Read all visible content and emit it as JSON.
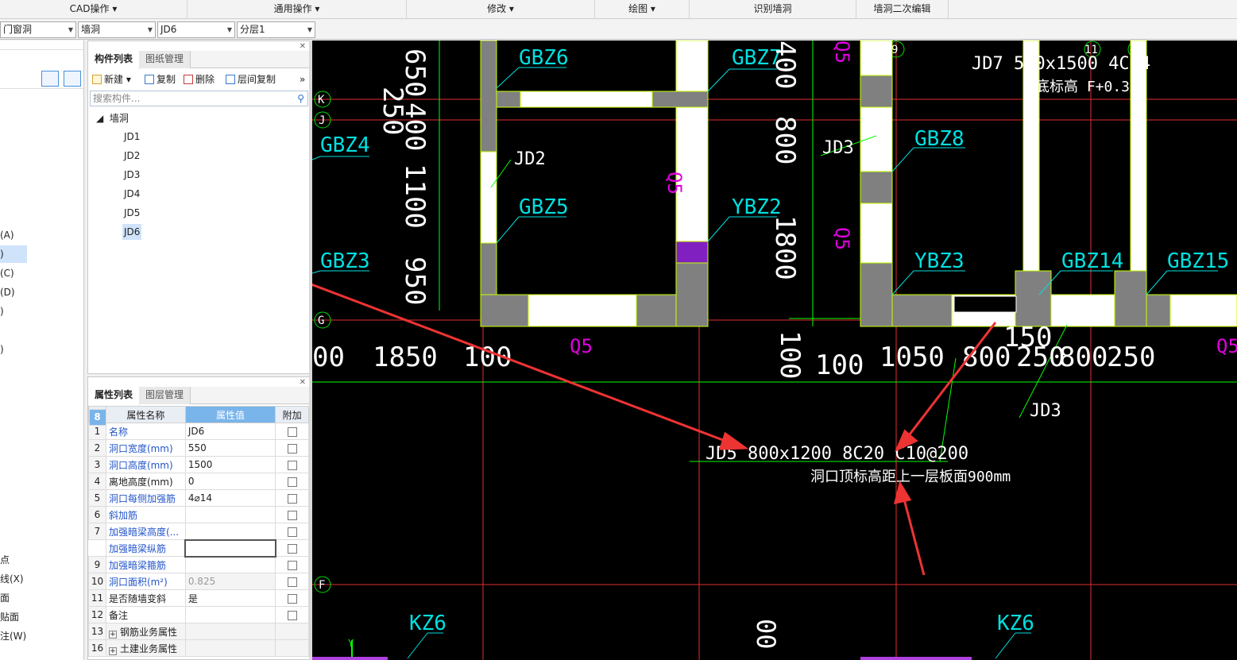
{
  "menu": {
    "items": [
      "CAD操作",
      "通用操作",
      "修改",
      "绘图",
      "识别墙洞",
      "墙洞二次编辑"
    ]
  },
  "selectors": {
    "type": "门窗洞",
    "subtype": "墙洞",
    "component": "JD6",
    "layer": "分层1"
  },
  "left_strip": {
    "items": [
      "(A)",
      ")",
      "(C)",
      "(D)",
      ")",
      ")",
      "点",
      "线(X)",
      "面",
      "贴面",
      "注(W)"
    ]
  },
  "component_panel": {
    "tab_active": "构件列表",
    "tab_inactive": "图纸管理",
    "new_label": "新建",
    "copy_label": "复制",
    "delete_label": "删除",
    "floor_copy_label": "层间复制",
    "more": "»",
    "search_placeholder": "搜索构件...",
    "tree_root": "墙洞",
    "items": [
      "JD1",
      "JD2",
      "JD3",
      "JD4",
      "JD5",
      "JD6"
    ],
    "selected": "JD6"
  },
  "property_panel": {
    "tab_active": "属性列表",
    "tab_inactive": "图层管理",
    "col_name": "属性名称",
    "col_value": "属性值",
    "col_extra": "附加",
    "rows": [
      {
        "n": "1",
        "name": "名称",
        "value": "JD6"
      },
      {
        "n": "2",
        "name": "洞口宽度(mm)",
        "value": "550"
      },
      {
        "n": "3",
        "name": "洞口高度(mm)",
        "value": "1500"
      },
      {
        "n": "4",
        "name": "离地高度(mm)",
        "value": "0"
      },
      {
        "n": "5",
        "name": "洞口每侧加强筋",
        "value": "4⌀14"
      },
      {
        "n": "6",
        "name": "斜加筋",
        "value": ""
      },
      {
        "n": "7",
        "name": "加强暗梁高度(...",
        "value": ""
      },
      {
        "n": "8",
        "name": "加强暗梁纵筋",
        "value": ""
      },
      {
        "n": "9",
        "name": "加强暗梁箍筋",
        "value": ""
      },
      {
        "n": "10",
        "name": "洞口面积(m²)",
        "value": "0.825"
      },
      {
        "n": "11",
        "name": "是否随墙变斜",
        "value": "是"
      },
      {
        "n": "12",
        "name": "备注",
        "value": ""
      },
      {
        "n": "13",
        "name": "钢筋业务属性",
        "value": ""
      },
      {
        "n": "16",
        "name": "土建业务属性",
        "value": ""
      }
    ]
  },
  "cad": {
    "axis_labels": [
      "K",
      "J",
      "G",
      "F",
      "9",
      "11"
    ],
    "dimensions": [
      "650",
      "250",
      "400",
      "1100",
      "950",
      "400",
      "800",
      "1800",
      "100",
      "00",
      "1850",
      "100",
      "100",
      "1050",
      "800",
      "250",
      "800",
      "250",
      "150"
    ],
    "walls": [
      "Q5",
      "Q5",
      "Q5",
      "Q5",
      "Q5"
    ],
    "columns": [
      "GBZ6",
      "GBZ7",
      "GBZ4",
      "GBZ5",
      "YBZ2",
      "GBZ3",
      "GBZ8",
      "YBZ3",
      "GBZ14",
      "GBZ15",
      "KZ6",
      "KZ6",
      "JD2",
      "JD3",
      "JD3"
    ],
    "jd7_label": "JD7 550x1500 4C14",
    "jd7_elev": "底标高 F+0.350",
    "annotation_main": "JD5 800x1200   8C20 C10@200",
    "annotation_sub": "洞口顶标高距上一层板面900mm",
    "partial_top": [
      "GBZ6",
      "GBZ4"
    ],
    "y_axis": "Y",
    "colors": {
      "background": "#000000",
      "wall": "#ffffff",
      "column": "#808080",
      "axis": "#e03030",
      "dim": "#00ff00",
      "text": "#ffffff",
      "label": "#00e0e0",
      "wall_label": "#e000e0",
      "arrow": "#ee3333"
    }
  }
}
